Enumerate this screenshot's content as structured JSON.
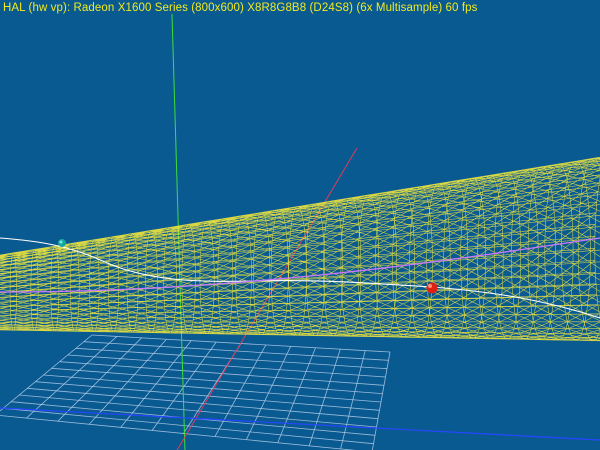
{
  "hud": {
    "stats": "HAL (hw vp): Radeon X1600 Series  (800x600) X8R8G8B8 (D24S8) (6x Multisample) 60 fps"
  },
  "scene": {
    "background_color": "#0a5a92",
    "text_color": "#f0ea20",
    "wireframe_color": "#f0e63c",
    "grid_color": "#b4cde6",
    "axis_x_color": "#dc3c5a",
    "axis_y_color": "#3cdc3c",
    "axis_z_color": "#2846ff",
    "curve_color": "#ffffff",
    "path_color": "#c878ff",
    "marker_red_color": "#e02010",
    "marker_teal_color": "#12a8a0",
    "cylinder_rings": 34,
    "cylinder_segments": 48,
    "grid_divisions": 12
  }
}
